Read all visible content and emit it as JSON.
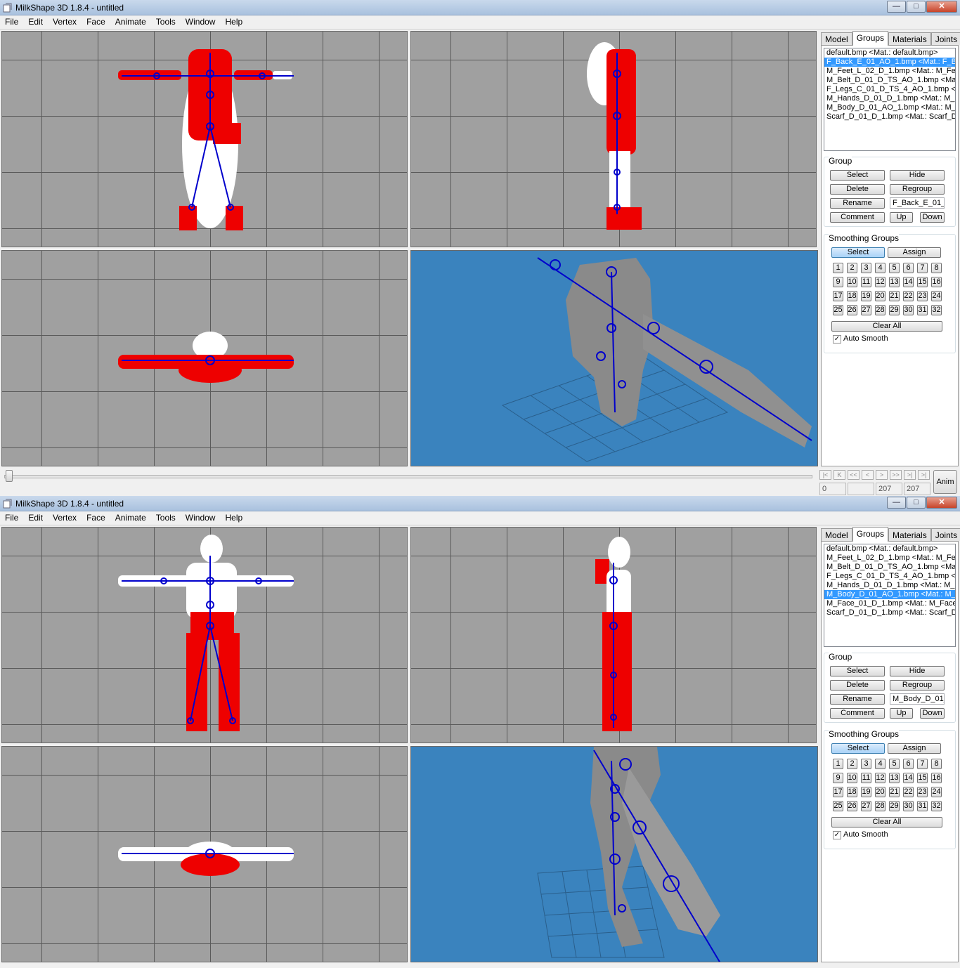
{
  "windows": [
    {
      "title": "MilkShape 3D 1.8.4 - untitled",
      "menu": [
        "File",
        "Edit",
        "Vertex",
        "Face",
        "Animate",
        "Tools",
        "Window",
        "Help"
      ],
      "tabs": [
        "Model",
        "Groups",
        "Materials",
        "Joints"
      ],
      "active_tab": "Groups",
      "groups": [
        "default.bmp <Mat.: default.bmp>",
        "F_Back_E_01_AO_1.bmp <Mat.: F_Ba",
        "M_Feet_L_02_D_1.bmp <Mat.: M_Fee",
        "M_Belt_D_01_D_TS_AO_1.bmp <Mat",
        "F_Legs_C_01_D_TS_4_AO_1.bmp <N",
        "M_Hands_D_01_D_1.bmp <Mat.: M_H",
        "M_Body_D_01_AO_1.bmp <Mat.: M_E",
        "Scarf_D_01_D_1.bmp <Mat.: Scarf_D"
      ],
      "selected_group": 1,
      "group_section": {
        "label": "Group",
        "select": "Select",
        "hide": "Hide",
        "delete": "Delete",
        "regroup": "Regroup",
        "rename": "Rename",
        "name_value": "F_Back_E_01_",
        "comment": "Comment",
        "up": "Up",
        "down": "Down"
      },
      "smoothing": {
        "label": "Smoothing Groups",
        "select": "Select",
        "assign": "Assign",
        "numbers": [
          "1",
          "2",
          "3",
          "4",
          "5",
          "6",
          "7",
          "8",
          "9",
          "10",
          "11",
          "12",
          "13",
          "14",
          "15",
          "16",
          "17",
          "18",
          "19",
          "20",
          "21",
          "22",
          "23",
          "24",
          "25",
          "26",
          "27",
          "28",
          "29",
          "30",
          "31",
          "32"
        ],
        "clear_all": "Clear All",
        "auto_smooth": "Auto Smooth",
        "auto_smooth_checked": true
      },
      "timeline": {
        "frame": "0",
        "blank": "",
        "end1": "207",
        "end2": "207",
        "anim": "Anim"
      }
    },
    {
      "title": "MilkShape 3D 1.8.4 - untitled",
      "menu": [
        "File",
        "Edit",
        "Vertex",
        "Face",
        "Animate",
        "Tools",
        "Window",
        "Help"
      ],
      "tabs": [
        "Model",
        "Groups",
        "Materials",
        "Joints"
      ],
      "active_tab": "Groups",
      "groups": [
        "default.bmp <Mat.: default.bmp>",
        "M_Feet_L_02_D_1.bmp <Mat.: M_Fee",
        "M_Belt_D_01_D_TS_AO_1.bmp <Mat",
        "F_Legs_C_01_D_TS_4_AO_1.bmp <N",
        "M_Hands_D_01_D_1.bmp <Mat.: M_H",
        "M_Body_D_01_AO_1.bmp <Mat.: M_E",
        "M_Face_01_D_1.bmp <Mat.: M_Face",
        "Scarf_D_01_D_1.bmp <Mat.: Scarf_D"
      ],
      "selected_group": 5,
      "group_section": {
        "label": "Group",
        "select": "Select",
        "hide": "Hide",
        "delete": "Delete",
        "regroup": "Regroup",
        "rename": "Rename",
        "name_value": "M_Body_D_01_",
        "comment": "Comment",
        "up": "Up",
        "down": "Down"
      },
      "smoothing": {
        "label": "Smoothing Groups",
        "select": "Select",
        "assign": "Assign",
        "numbers": [
          "1",
          "2",
          "3",
          "4",
          "5",
          "6",
          "7",
          "8",
          "9",
          "10",
          "11",
          "12",
          "13",
          "14",
          "15",
          "16",
          "17",
          "18",
          "19",
          "20",
          "21",
          "22",
          "23",
          "24",
          "25",
          "26",
          "27",
          "28",
          "29",
          "30",
          "31",
          "32"
        ],
        "clear_all": "Clear All",
        "auto_smooth": "Auto Smooth",
        "auto_smooth_checked": true
      }
    }
  ],
  "colors": {
    "selected_mesh": "#ff0000",
    "unselected_mesh": "#ffffff",
    "skeleton": "#0000cc",
    "viewport_grey": "#a0a0a0",
    "viewport_3d": "#3a83be",
    "selection": "#3399ff"
  }
}
